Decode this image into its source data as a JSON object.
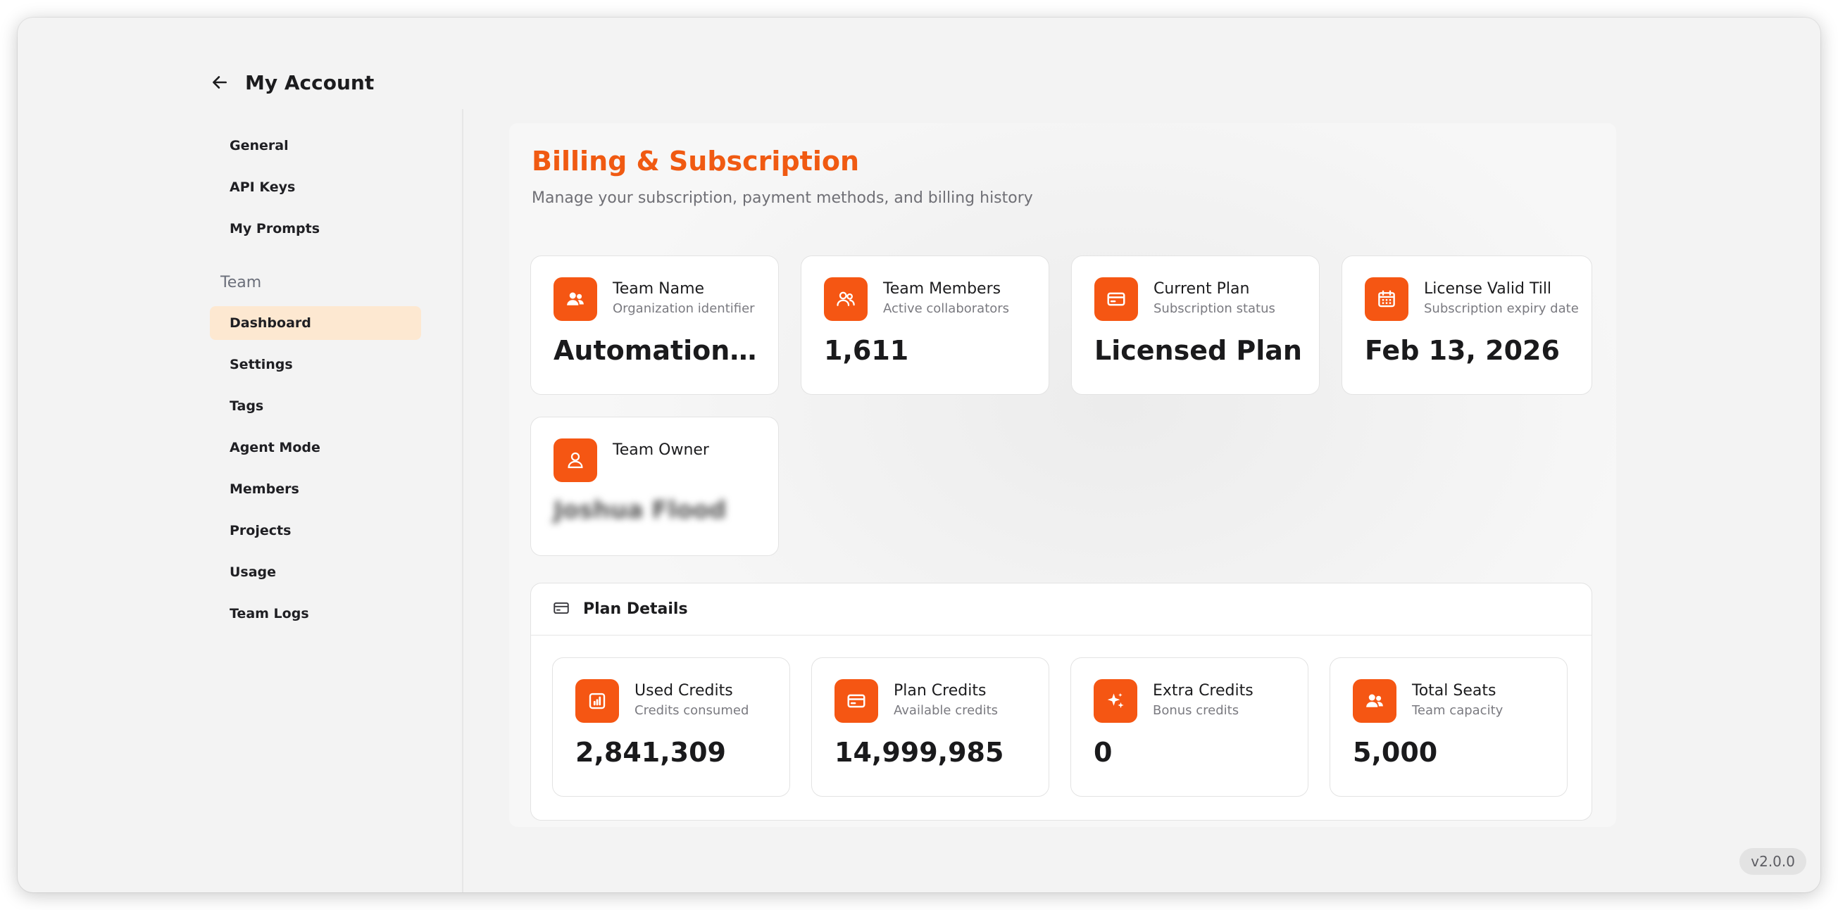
{
  "header": {
    "title": "My Account"
  },
  "sidebar": {
    "items": [
      {
        "label": "General"
      },
      {
        "label": "API Keys"
      },
      {
        "label": "My Prompts"
      }
    ],
    "group_label": "Team",
    "team_items": [
      {
        "label": "Dashboard",
        "active": true
      },
      {
        "label": "Settings"
      },
      {
        "label": "Tags"
      },
      {
        "label": "Agent Mode"
      },
      {
        "label": "Members"
      },
      {
        "label": "Projects"
      },
      {
        "label": "Usage"
      },
      {
        "label": "Team Logs"
      }
    ]
  },
  "main": {
    "title": "Billing & Subscription",
    "subtitle": "Manage your subscription, payment methods, and billing history",
    "cards": [
      {
        "title": "Team Name",
        "sub": "Organization identifier",
        "value": "Automation A...",
        "icon": "users-icon"
      },
      {
        "title": "Team Members",
        "sub": "Active collaborators",
        "value": "1,611",
        "icon": "users-outline-icon"
      },
      {
        "title": "Current Plan",
        "sub": "Subscription status",
        "value": "Licensed Plan",
        "icon": "credit-card-icon"
      },
      {
        "title": "License Valid Till",
        "sub": "Subscription expiry date",
        "value": "Feb 13, 2026",
        "icon": "calendar-icon"
      },
      {
        "title": "Team Owner",
        "value": "Joshua Flood",
        "icon": "user-icon"
      }
    ],
    "plan_details": {
      "title": "Plan Details",
      "cards": [
        {
          "title": "Used Credits",
          "sub": "Credits consumed",
          "value": "2,841,309",
          "icon": "bar-chart-icon"
        },
        {
          "title": "Plan Credits",
          "sub": "Available credits",
          "value": "14,999,985",
          "icon": "credit-card-icon"
        },
        {
          "title": "Extra Credits",
          "sub": "Bonus credits",
          "value": "0",
          "icon": "sparkle-icon"
        },
        {
          "title": "Total Seats",
          "sub": "Team capacity",
          "value": "5,000",
          "icon": "users-icon"
        }
      ]
    }
  },
  "version": "v2.0.0",
  "colors": {
    "accent": "#f55613",
    "title_accent": "#f05a12",
    "active_bg": "#fde8d1"
  }
}
